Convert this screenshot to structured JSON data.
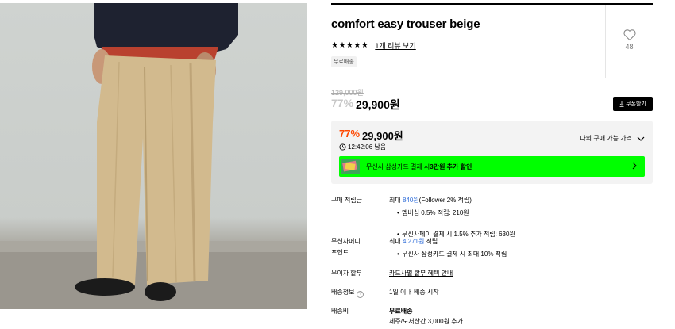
{
  "product": {
    "title": "comfort easy trouser beige",
    "rating_stars": "★★★★★",
    "review_link": "1개 리뷰 보기",
    "badge": "무료배송",
    "like_count": "48"
  },
  "price": {
    "original": "129,000원",
    "discount_rate": "77%",
    "sale": "29,900원",
    "coupon_button": "쿠폰받기"
  },
  "benefit": {
    "discount_rate": "77%",
    "price": "29,900원",
    "timer": "12:42:06 남음",
    "my_price_label": "나의 구매 가능 가격",
    "promo_prefix": "무신사 삼성카드 결제 시 ",
    "promo_strong": "3만원 추가 할인"
  },
  "info": {
    "points_label": "구매 적립금",
    "points_prefix": "최대 ",
    "points_amount": "840원",
    "points_suffix": "(Follower 2% 적립)",
    "points_bullet1": "멤버십 0.5% 적립: 210원",
    "points_bullet2": "무신사페이 결제 시 1.5% 추가 적립: 630원",
    "money_label_1": "무신사머니",
    "money_label_2": "포인트",
    "money_prefix": "최대 ",
    "money_amount": "4,271원",
    "money_suffix": " 적립",
    "money_bullet": "무신사 삼성카드 결제 시 최대 10% 적립",
    "installment_label": "무이자 할부",
    "installment_link": "카드사별 할부 혜택 안내",
    "shipping_info_label": "배송정보",
    "shipping_info_value": "1일 이내 배송 시작",
    "shipping_fee_label": "배송비",
    "shipping_fee_value": "무료배송",
    "shipping_fee_note": "제주/도서산간 3,000원 추가"
  },
  "colors": {
    "accent_orange": "#ff4800",
    "promo_green": "#00ff00",
    "link_blue": "#2c6bd8"
  },
  "icons": [
    "heart-icon",
    "download-icon",
    "clock-icon",
    "chevron-down-icon",
    "chevron-right-icon",
    "question-icon"
  ]
}
